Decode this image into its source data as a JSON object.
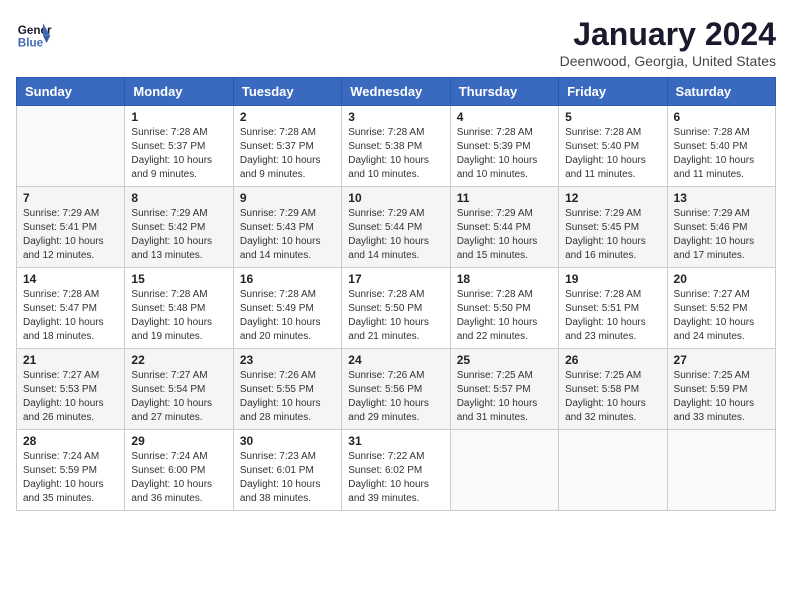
{
  "logo": {
    "text_general": "General",
    "text_blue": "Blue"
  },
  "header": {
    "title": "January 2024",
    "subtitle": "Deenwood, Georgia, United States"
  },
  "days_of_week": [
    "Sunday",
    "Monday",
    "Tuesday",
    "Wednesday",
    "Thursday",
    "Friday",
    "Saturday"
  ],
  "weeks": [
    [
      {
        "day": "",
        "info": ""
      },
      {
        "day": "1",
        "info": "Sunrise: 7:28 AM\nSunset: 5:37 PM\nDaylight: 10 hours\nand 9 minutes."
      },
      {
        "day": "2",
        "info": "Sunrise: 7:28 AM\nSunset: 5:37 PM\nDaylight: 10 hours\nand 9 minutes."
      },
      {
        "day": "3",
        "info": "Sunrise: 7:28 AM\nSunset: 5:38 PM\nDaylight: 10 hours\nand 10 minutes."
      },
      {
        "day": "4",
        "info": "Sunrise: 7:28 AM\nSunset: 5:39 PM\nDaylight: 10 hours\nand 10 minutes."
      },
      {
        "day": "5",
        "info": "Sunrise: 7:28 AM\nSunset: 5:40 PM\nDaylight: 10 hours\nand 11 minutes."
      },
      {
        "day": "6",
        "info": "Sunrise: 7:28 AM\nSunset: 5:40 PM\nDaylight: 10 hours\nand 11 minutes."
      }
    ],
    [
      {
        "day": "7",
        "info": "Sunrise: 7:29 AM\nSunset: 5:41 PM\nDaylight: 10 hours\nand 12 minutes."
      },
      {
        "day": "8",
        "info": "Sunrise: 7:29 AM\nSunset: 5:42 PM\nDaylight: 10 hours\nand 13 minutes."
      },
      {
        "day": "9",
        "info": "Sunrise: 7:29 AM\nSunset: 5:43 PM\nDaylight: 10 hours\nand 14 minutes."
      },
      {
        "day": "10",
        "info": "Sunrise: 7:29 AM\nSunset: 5:44 PM\nDaylight: 10 hours\nand 14 minutes."
      },
      {
        "day": "11",
        "info": "Sunrise: 7:29 AM\nSunset: 5:44 PM\nDaylight: 10 hours\nand 15 minutes."
      },
      {
        "day": "12",
        "info": "Sunrise: 7:29 AM\nSunset: 5:45 PM\nDaylight: 10 hours\nand 16 minutes."
      },
      {
        "day": "13",
        "info": "Sunrise: 7:29 AM\nSunset: 5:46 PM\nDaylight: 10 hours\nand 17 minutes."
      }
    ],
    [
      {
        "day": "14",
        "info": "Sunrise: 7:28 AM\nSunset: 5:47 PM\nDaylight: 10 hours\nand 18 minutes."
      },
      {
        "day": "15",
        "info": "Sunrise: 7:28 AM\nSunset: 5:48 PM\nDaylight: 10 hours\nand 19 minutes."
      },
      {
        "day": "16",
        "info": "Sunrise: 7:28 AM\nSunset: 5:49 PM\nDaylight: 10 hours\nand 20 minutes."
      },
      {
        "day": "17",
        "info": "Sunrise: 7:28 AM\nSunset: 5:50 PM\nDaylight: 10 hours\nand 21 minutes."
      },
      {
        "day": "18",
        "info": "Sunrise: 7:28 AM\nSunset: 5:50 PM\nDaylight: 10 hours\nand 22 minutes."
      },
      {
        "day": "19",
        "info": "Sunrise: 7:28 AM\nSunset: 5:51 PM\nDaylight: 10 hours\nand 23 minutes."
      },
      {
        "day": "20",
        "info": "Sunrise: 7:27 AM\nSunset: 5:52 PM\nDaylight: 10 hours\nand 24 minutes."
      }
    ],
    [
      {
        "day": "21",
        "info": "Sunrise: 7:27 AM\nSunset: 5:53 PM\nDaylight: 10 hours\nand 26 minutes."
      },
      {
        "day": "22",
        "info": "Sunrise: 7:27 AM\nSunset: 5:54 PM\nDaylight: 10 hours\nand 27 minutes."
      },
      {
        "day": "23",
        "info": "Sunrise: 7:26 AM\nSunset: 5:55 PM\nDaylight: 10 hours\nand 28 minutes."
      },
      {
        "day": "24",
        "info": "Sunrise: 7:26 AM\nSunset: 5:56 PM\nDaylight: 10 hours\nand 29 minutes."
      },
      {
        "day": "25",
        "info": "Sunrise: 7:25 AM\nSunset: 5:57 PM\nDaylight: 10 hours\nand 31 minutes."
      },
      {
        "day": "26",
        "info": "Sunrise: 7:25 AM\nSunset: 5:58 PM\nDaylight: 10 hours\nand 32 minutes."
      },
      {
        "day": "27",
        "info": "Sunrise: 7:25 AM\nSunset: 5:59 PM\nDaylight: 10 hours\nand 33 minutes."
      }
    ],
    [
      {
        "day": "28",
        "info": "Sunrise: 7:24 AM\nSunset: 5:59 PM\nDaylight: 10 hours\nand 35 minutes."
      },
      {
        "day": "29",
        "info": "Sunrise: 7:24 AM\nSunset: 6:00 PM\nDaylight: 10 hours\nand 36 minutes."
      },
      {
        "day": "30",
        "info": "Sunrise: 7:23 AM\nSunset: 6:01 PM\nDaylight: 10 hours\nand 38 minutes."
      },
      {
        "day": "31",
        "info": "Sunrise: 7:22 AM\nSunset: 6:02 PM\nDaylight: 10 hours\nand 39 minutes."
      },
      {
        "day": "",
        "info": ""
      },
      {
        "day": "",
        "info": ""
      },
      {
        "day": "",
        "info": ""
      }
    ]
  ]
}
